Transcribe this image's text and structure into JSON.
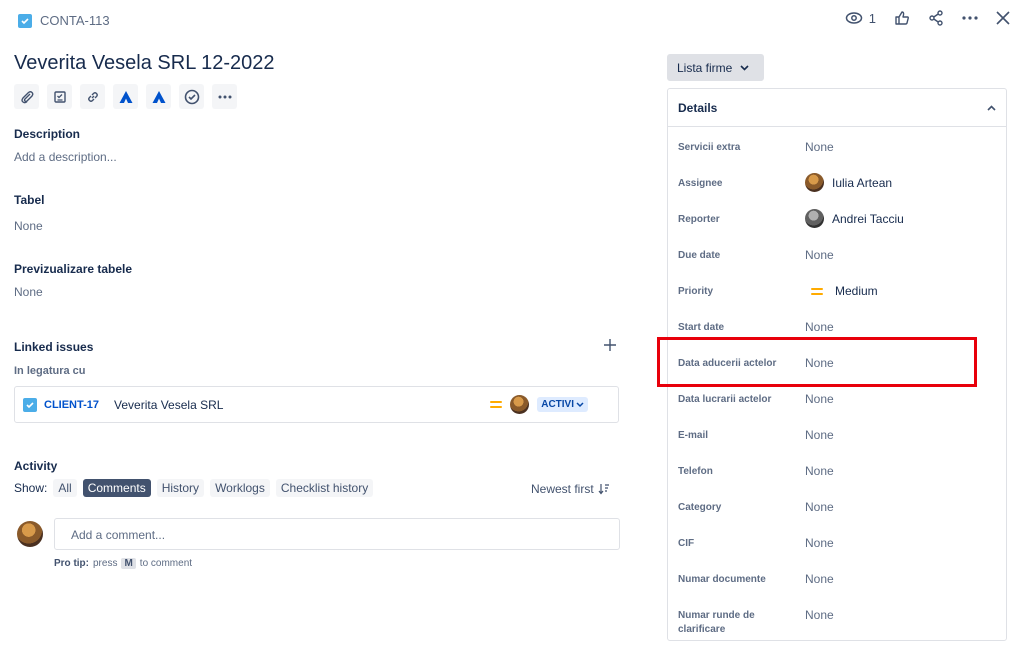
{
  "header": {
    "issue_key": "CONTA-113",
    "watch_count": "1"
  },
  "issue": {
    "title": "Veverita Vesela SRL 12-2022"
  },
  "description": {
    "label": "Description",
    "placeholder": "Add a description..."
  },
  "tabel": {
    "label": "Tabel",
    "value": "None"
  },
  "previzualizare": {
    "label": "Previzualizare tabele",
    "value": "None"
  },
  "linked": {
    "label": "Linked issues",
    "relation": "In legatura cu",
    "item": {
      "key": "CLIENT-17",
      "summary": "Veverita Vesela SRL",
      "status": "ACTIVI"
    }
  },
  "activity": {
    "label": "Activity",
    "show_label": "Show:",
    "filters": [
      "All",
      "Comments",
      "History",
      "Worklogs",
      "Checklist history"
    ],
    "active_filter": "Comments",
    "sort": "Newest first",
    "comment_placeholder": "Add a comment...",
    "protip_bold": "Pro tip:",
    "protip_pre": "press",
    "protip_key": "M",
    "protip_post": "to comment"
  },
  "sidebar": {
    "lista_label": "Lista firme",
    "details_label": "Details",
    "fields": [
      {
        "label": "Servicii extra",
        "value": "None"
      },
      {
        "label": "Assignee",
        "value": "Iulia Artean"
      },
      {
        "label": "Reporter",
        "value": "Andrei Tacciu"
      },
      {
        "label": "Due date",
        "value": "None"
      },
      {
        "label": "Priority",
        "value": "Medium"
      },
      {
        "label": "Start date",
        "value": "None"
      },
      {
        "label": "Data aducerii actelor",
        "value": "None"
      },
      {
        "label": "Data lucrarii actelor",
        "value": "None"
      },
      {
        "label": "E-mail",
        "value": "None"
      },
      {
        "label": "Telefon",
        "value": "None"
      },
      {
        "label": "Category",
        "value": "None"
      },
      {
        "label": "CIF",
        "value": "None"
      },
      {
        "label": "Numar documente",
        "value": "None"
      },
      {
        "label": "Numar runde de clarificare",
        "value": "None"
      }
    ]
  },
  "colors": {
    "accent": "#0052cc",
    "highlight": "#e8000b",
    "priority_medium": "#ffab00"
  }
}
